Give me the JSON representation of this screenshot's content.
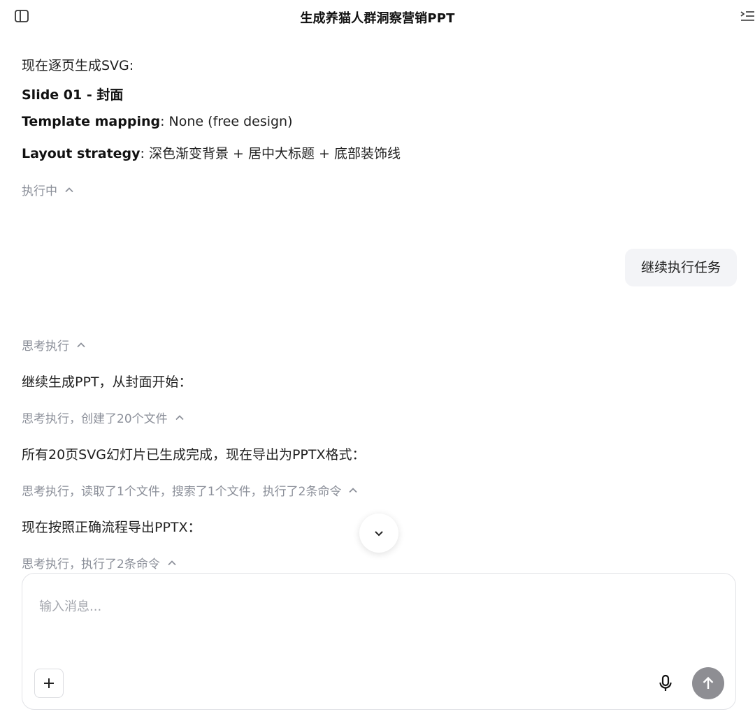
{
  "header": {
    "title": "生成养猫人群洞察营销PPT",
    "sidebar_icon": "sidebar-panel-icon",
    "outline_icon": "outline-list-icon"
  },
  "messages": {
    "intro": "现在逐页生成SVG:",
    "slide_title": "Slide 01 - 封面",
    "template_label": "Template mapping",
    "template_value": ": None (free design)",
    "layout_label": "Layout strategy",
    "layout_value": ": 深色渐变背景 + 居中大标题 + 底部装饰线",
    "running_status": "执行中",
    "user_message": "继续执行任务",
    "thinking_1": "思考执行",
    "reply_1": "继续生成PPT，从封面开始：",
    "thinking_2": "思考执行，创建了20个文件",
    "reply_2": "所有20页SVG幻灯片已生成完成，现在导出为PPTX格式：",
    "thinking_3": "思考执行，读取了1个文件，搜索了1个文件，执行了2条命令",
    "reply_3": "现在按照正确流程导出PPTX：",
    "thinking_4": "思考执行，执行了2条命令"
  },
  "composer": {
    "placeholder": "输入消息...",
    "value": ""
  },
  "colors": {
    "muted_text": "#8b8f99",
    "bubble_bg": "#f3f4f7",
    "send_button": "#8e8e93"
  }
}
